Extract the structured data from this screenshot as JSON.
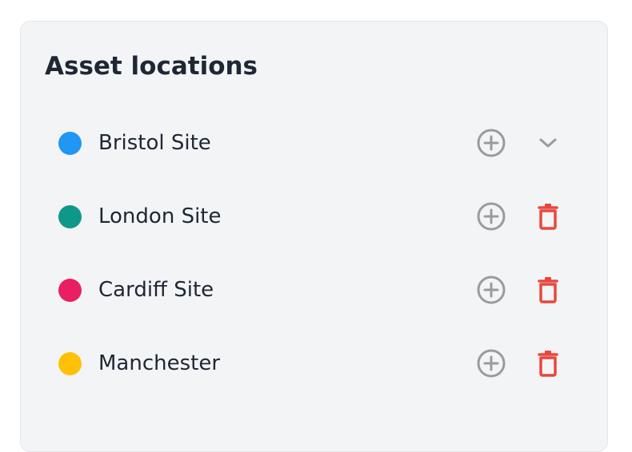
{
  "panel": {
    "title": "Asset locations"
  },
  "locations": [
    {
      "name": "Bristol Site",
      "color": "#2196f3",
      "action_icon": "chevron-down-icon"
    },
    {
      "name": "London Site",
      "color": "#0f9889",
      "action_icon": "trash-icon"
    },
    {
      "name": "Cardiff Site",
      "color": "#e91e63",
      "action_icon": "trash-icon"
    },
    {
      "name": "Manchester",
      "color": "#ffc107",
      "action_icon": "trash-icon"
    }
  ],
  "icons": {
    "add": "plus-circle-icon",
    "expand": "chevron-down-icon",
    "delete": "trash-icon"
  },
  "colors": {
    "panel_background": "#f3f4f6",
    "text": "#1f2733",
    "icon_gray": "#9b9b9b",
    "delete_red": "#e8473b"
  }
}
